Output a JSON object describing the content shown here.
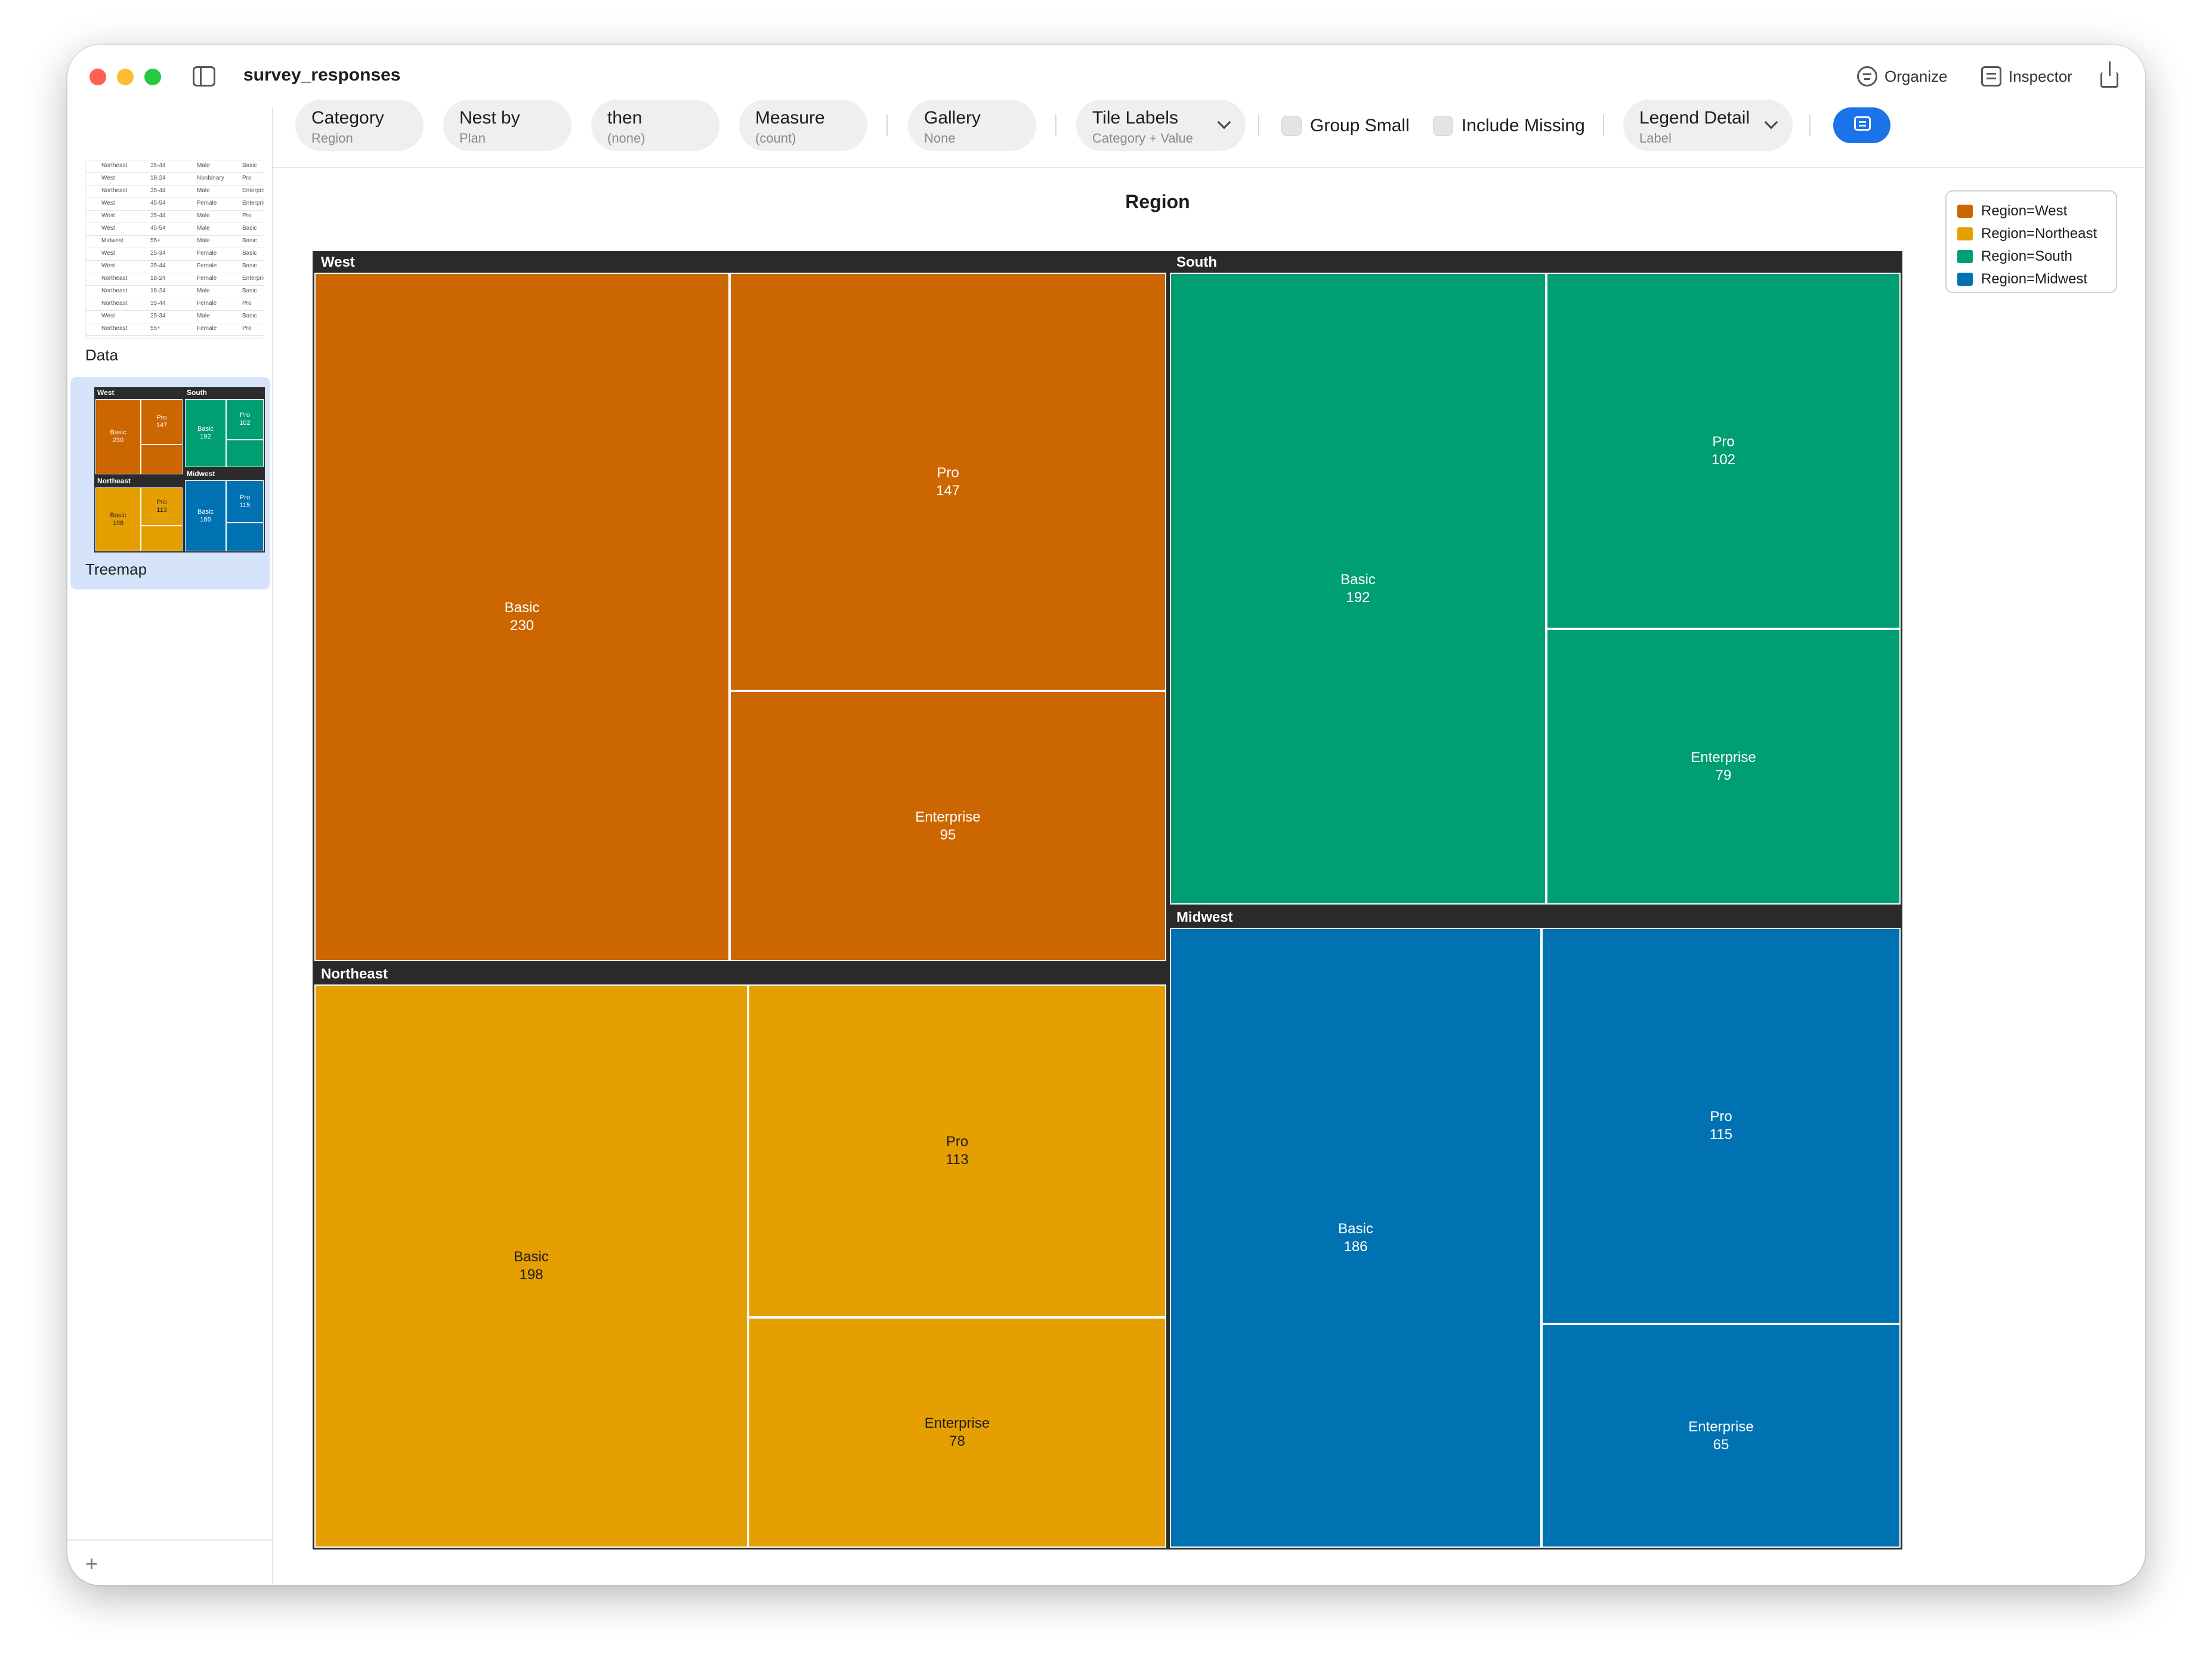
{
  "window": {
    "title": "survey_responses",
    "toolbar_right": {
      "organize": "Organize",
      "inspector": "Inspector"
    }
  },
  "sidebar": {
    "items": [
      {
        "label": "Data",
        "selected": false
      },
      {
        "label": "Treemap",
        "selected": true
      }
    ],
    "add_label": "+",
    "data_preview_rows": [
      [
        "Northeast",
        "35-44",
        "Male",
        "Basic"
      ],
      [
        "West",
        "18-24",
        "Nonbinary",
        "Pro"
      ],
      [
        "Northeast",
        "35-44",
        "Male",
        "Enterprise"
      ],
      [
        "West",
        "45-54",
        "Female",
        "Enterprise"
      ],
      [
        "West",
        "35-44",
        "Male",
        "Pro"
      ],
      [
        "West",
        "45-54",
        "Male",
        "Basic"
      ],
      [
        "Midwest",
        "55+",
        "Male",
        "Basic"
      ],
      [
        "West",
        "25-34",
        "Female",
        "Basic"
      ],
      [
        "West",
        "35-44",
        "Female",
        "Basic"
      ],
      [
        "Northeast",
        "18-24",
        "Female",
        "Enterprise"
      ],
      [
        "Northeast",
        "18-24",
        "Male",
        "Basic"
      ],
      [
        "Northeast",
        "35-44",
        "Female",
        "Pro"
      ],
      [
        "West",
        "25-34",
        "Male",
        "Basic"
      ],
      [
        "Northeast",
        "55+",
        "Female",
        "Pro"
      ]
    ]
  },
  "toolbar": {
    "category": {
      "label": "Category",
      "value": "Region"
    },
    "nest_by": {
      "label": "Nest by",
      "value": "Plan"
    },
    "then": {
      "label": "then",
      "value": "(none)"
    },
    "measure": {
      "label": "Measure",
      "value": "(count)"
    },
    "gallery": {
      "label": "Gallery",
      "value": "None"
    },
    "tile_labels": {
      "label": "Tile Labels",
      "value": "Category + Value"
    },
    "group_small": {
      "label": "Group Small",
      "checked": false
    },
    "include_missing": {
      "label": "Include Missing",
      "checked": false
    },
    "legend_detail": {
      "label": "Legend Detail",
      "value": "Label"
    }
  },
  "legend": {
    "items": [
      {
        "label": "Region=West",
        "color": "#cc6600"
      },
      {
        "label": "Region=Northeast",
        "color": "#e69f00"
      },
      {
        "label": "Region=South",
        "color": "#009e73"
      },
      {
        "label": "Region=Midwest",
        "color": "#0072b2"
      }
    ]
  },
  "chart_data": {
    "type": "treemap",
    "title": "Region",
    "group_field": "Region",
    "nest_field": "Plan",
    "groups": [
      {
        "name": "West",
        "color": "#cc6600",
        "children": [
          {
            "name": "Basic",
            "value": 230
          },
          {
            "name": "Pro",
            "value": 147
          },
          {
            "name": "Enterprise",
            "value": 95
          }
        ]
      },
      {
        "name": "Northeast",
        "color": "#e69f00",
        "children": [
          {
            "name": "Basic",
            "value": 198
          },
          {
            "name": "Pro",
            "value": 113
          },
          {
            "name": "Enterprise",
            "value": 78
          }
        ]
      },
      {
        "name": "South",
        "color": "#009e73",
        "children": [
          {
            "name": "Basic",
            "value": 192
          },
          {
            "name": "Pro",
            "value": 102
          },
          {
            "name": "Enterprise",
            "value": 79
          }
        ]
      },
      {
        "name": "Midwest",
        "color": "#0072b2",
        "children": [
          {
            "name": "Basic",
            "value": 186
          },
          {
            "name": "Pro",
            "value": 115
          },
          {
            "name": "Enterprise",
            "value": 65
          }
        ]
      }
    ]
  },
  "thumbnail": {
    "groups": [
      {
        "name": "West",
        "color": "#cc6600",
        "tiles": [
          [
            "Basic",
            "230"
          ],
          [
            "Pro",
            "147"
          ]
        ]
      },
      {
        "name": "South",
        "color": "#009e73",
        "tiles": [
          [
            "Basic",
            "192"
          ],
          [
            "Pro",
            "102"
          ]
        ]
      },
      {
        "name": "Northeast",
        "color": "#e69f00",
        "tiles": [
          [
            "Basic",
            "198"
          ],
          [
            "Pro",
            "113"
          ]
        ]
      },
      {
        "name": "Midwest",
        "color": "#0072b2",
        "tiles": [
          [
            "Basic",
            "186"
          ],
          [
            "Pro",
            "115"
          ]
        ]
      }
    ]
  }
}
